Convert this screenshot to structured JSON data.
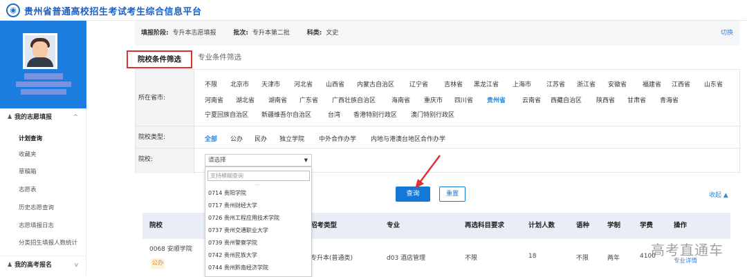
{
  "header": {
    "logo_glyph": "◉",
    "title": "贵州省普通高校招生考试考生综合信息平台"
  },
  "sidebar": {
    "group1_label": "我的志愿填报",
    "group1_chevron": "^",
    "items": [
      "计划查询",
      "收藏夹",
      "草稿箱",
      "志愿表",
      "历史志愿查询",
      "志愿填报日志",
      "分类招生填报人数统计"
    ],
    "group2_label": "我的高考报名",
    "group2_chevron": "v"
  },
  "stage": {
    "phase_label": "填报阶段:",
    "phase_value": "专升本志愿填报",
    "batch_label": "批次:",
    "batch_value": "专升本第二批",
    "subject_label": "科类:",
    "subject_value": "文史",
    "switch_label": "切换"
  },
  "tabs": {
    "school": "院校条件筛选",
    "major": "专业条件筛选"
  },
  "filters": {
    "province_label": "所在省市:",
    "provinces_row1": [
      "不限",
      "北京市",
      "天津市",
      "河北省",
      "山西省",
      "内蒙古自治区",
      "辽宁省",
      "吉林省",
      "黑龙江省",
      "上海市",
      "江苏省",
      "浙江省",
      "安徽省",
      "福建省",
      "江西省",
      "山东省"
    ],
    "provinces_row2": [
      "河南省",
      "湖北省",
      "湖南省",
      "广东省",
      "广西壮族自治区",
      "海南省",
      "重庆市",
      "四川省",
      "贵州省",
      "云南省",
      "西藏自治区",
      "陕西省",
      "甘肃省",
      "青海省"
    ],
    "provinces_row3": [
      "宁夏回族自治区",
      "新疆维吾尔自治区",
      "台湾",
      "香港特别行政区",
      "澳门特别行政区"
    ],
    "selected_province": "贵州省",
    "type_label": "院校类型:",
    "types": [
      "全部",
      "公办",
      "民办",
      "独立学院",
      "中外合作办学",
      "内地与港澳台地区合作办学"
    ],
    "selected_type": "全部",
    "school_label": "院校:",
    "school_select": "请选择",
    "school_search_placeholder": "支持模糊查询",
    "school_options": [
      "0714 贵阳学院",
      "0717 贵州财经大学",
      "0726 贵州工程应用技术学院",
      "0737 贵州交通职业大学",
      "0739 贵州警察学院",
      "0742 贵州民族大学",
      "0744 贵州黔南经济学院"
    ]
  },
  "actions": {
    "query": "查询",
    "reset": "重置",
    "collapse": "收起 ▲"
  },
  "results": {
    "columns": [
      "院校",
      "招考类型",
      "专业",
      "再选科目要求",
      "计划人数",
      "语种",
      "学制",
      "学费",
      "操作"
    ],
    "rows": [
      {
        "school": "0068 安顺学院",
        "badge": "公办",
        "type": "专升本(普通类)",
        "major": "d03 酒店管理",
        "req": "不限",
        "plan": "18",
        "lang": "不限",
        "years": "两年",
        "fee": "4100",
        "action": "专业详情"
      }
    ]
  },
  "watermark": "高考直通车",
  "colors": {
    "accent": "#1479d6",
    "profile_bg": "#1c7de0",
    "highlight_box": "#e03030",
    "selected": "#2a85d9"
  }
}
